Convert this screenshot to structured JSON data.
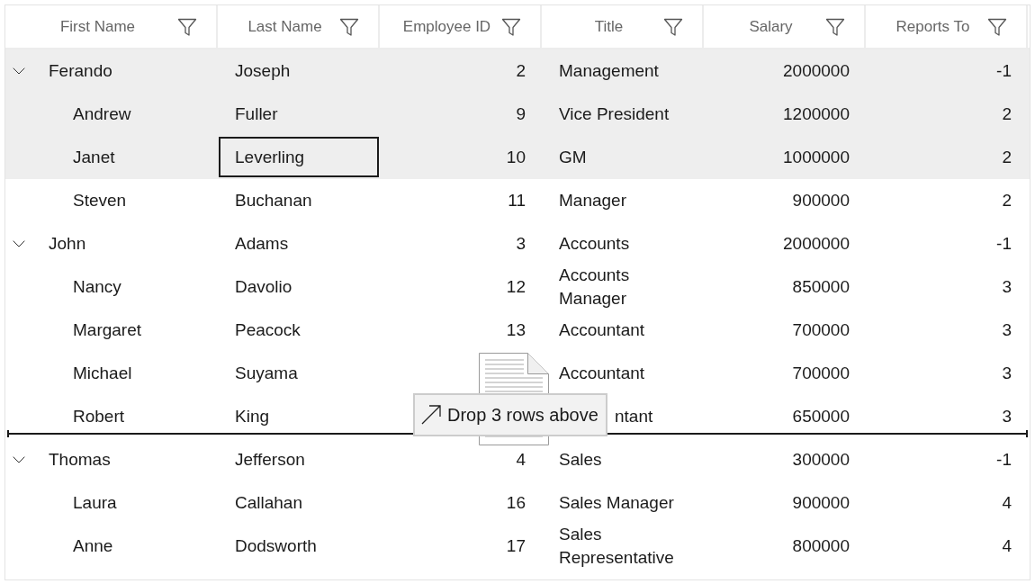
{
  "columns": [
    "First Name",
    "Last Name",
    "Employee ID",
    "Title",
    "Salary",
    "Reports To"
  ],
  "rows": [
    {
      "cells": [
        {
          "text": "Ferando",
          "focused": false
        },
        {
          "text": "Joseph",
          "focused": false
        },
        {
          "text": "2",
          "focused": false
        },
        {
          "text": "Management",
          "focused": false
        },
        {
          "text": "2000000",
          "focused": false
        },
        {
          "text": "-1",
          "focused": false
        }
      ],
      "selected": true,
      "drop_above": false,
      "expanded": true,
      "children": [
        {
          "cells": [
            {
              "text": "Andrew",
              "focused": false
            },
            {
              "text": "Fuller",
              "focused": false
            },
            {
              "text": "9",
              "focused": false
            },
            {
              "text": "Vice President",
              "focused": false
            },
            {
              "text": "1200000",
              "focused": false
            },
            {
              "text": "2",
              "focused": false
            }
          ],
          "selected": true,
          "drop_above": false
        },
        {
          "cells": [
            {
              "text": "Janet",
              "focused": false
            },
            {
              "text": "Leverling",
              "focused": true
            },
            {
              "text": "10",
              "focused": false
            },
            {
              "text": "GM",
              "focused": false
            },
            {
              "text": "1000000",
              "focused": false
            },
            {
              "text": "2",
              "focused": false
            }
          ],
          "selected": true,
          "drop_above": false
        },
        {
          "cells": [
            {
              "text": "Steven",
              "focused": false
            },
            {
              "text": "Buchanan",
              "focused": false
            },
            {
              "text": "11",
              "focused": false
            },
            {
              "text": "Manager",
              "focused": false
            },
            {
              "text": "900000",
              "focused": false
            },
            {
              "text": "2",
              "focused": false
            }
          ],
          "selected": false,
          "drop_above": false
        }
      ]
    },
    {
      "cells": [
        {
          "text": "John",
          "focused": false
        },
        {
          "text": "Adams",
          "focused": false
        },
        {
          "text": "3",
          "focused": false
        },
        {
          "text": "Accounts",
          "focused": false
        },
        {
          "text": "2000000",
          "focused": false
        },
        {
          "text": "-1",
          "focused": false
        }
      ],
      "selected": false,
      "drop_above": false,
      "expanded": true,
      "children": [
        {
          "cells": [
            {
              "text": "Nancy",
              "focused": false
            },
            {
              "text": "Davolio",
              "focused": false
            },
            {
              "text": "12",
              "focused": false
            },
            {
              "text": "Accounts Manager",
              "focused": false
            },
            {
              "text": "850000",
              "focused": false
            },
            {
              "text": "3",
              "focused": false
            }
          ],
          "selected": false,
          "drop_above": false
        },
        {
          "cells": [
            {
              "text": "Margaret",
              "focused": false
            },
            {
              "text": "Peacock",
              "focused": false
            },
            {
              "text": "13",
              "focused": false
            },
            {
              "text": "Accountant",
              "focused": false
            },
            {
              "text": "700000",
              "focused": false
            },
            {
              "text": "3",
              "focused": false
            }
          ],
          "selected": false,
          "drop_above": false
        },
        {
          "cells": [
            {
              "text": "Michael",
              "focused": false
            },
            {
              "text": "Suyama",
              "focused": false
            },
            {
              "focused": false
            },
            {
              "text": "Accountant",
              "focused": false
            },
            {
              "text": "700000",
              "focused": false
            },
            {
              "text": "3",
              "focused": false
            }
          ],
          "selected": false,
          "drop_above": false
        },
        {
          "cells": [
            {
              "text": "Robert",
              "focused": false
            },
            {
              "text": "King",
              "focused": false
            },
            {
              "focused": false
            },
            {
              "text": "ntant",
              "focused": false
            },
            {
              "text": "650000",
              "focused": false
            },
            {
              "text": "3",
              "focused": false
            }
          ],
          "selected": false,
          "drop_above": false
        }
      ]
    },
    {
      "cells": [
        {
          "text": "Thomas",
          "focused": false
        },
        {
          "text": "Jefferson",
          "focused": false
        },
        {
          "text": "4",
          "focused": false
        },
        {
          "text": "Sales",
          "focused": false
        },
        {
          "text": "300000",
          "focused": false
        },
        {
          "text": "-1",
          "focused": false
        }
      ],
      "selected": false,
      "drop_above": true,
      "expanded": true,
      "children": [
        {
          "cells": [
            {
              "text": "Laura",
              "focused": false
            },
            {
              "text": "Callahan",
              "focused": false
            },
            {
              "text": "16",
              "focused": false
            },
            {
              "text": "Sales Manager",
              "focused": false
            },
            {
              "text": "900000",
              "focused": false
            },
            {
              "text": "4",
              "focused": false
            }
          ],
          "selected": false,
          "drop_above": false
        },
        {
          "cells": [
            {
              "text": "Anne",
              "focused": false
            },
            {
              "text": "Dodsworth",
              "focused": false
            },
            {
              "text": "17",
              "focused": false
            },
            {
              "text": "Sales Representative",
              "focused": false
            },
            {
              "text": "800000",
              "focused": false
            },
            {
              "text": "4",
              "focused": false
            }
          ],
          "selected": false,
          "drop_above": false
        }
      ]
    }
  ],
  "drag_preview": {
    "text": "Drop 3 rows above"
  }
}
